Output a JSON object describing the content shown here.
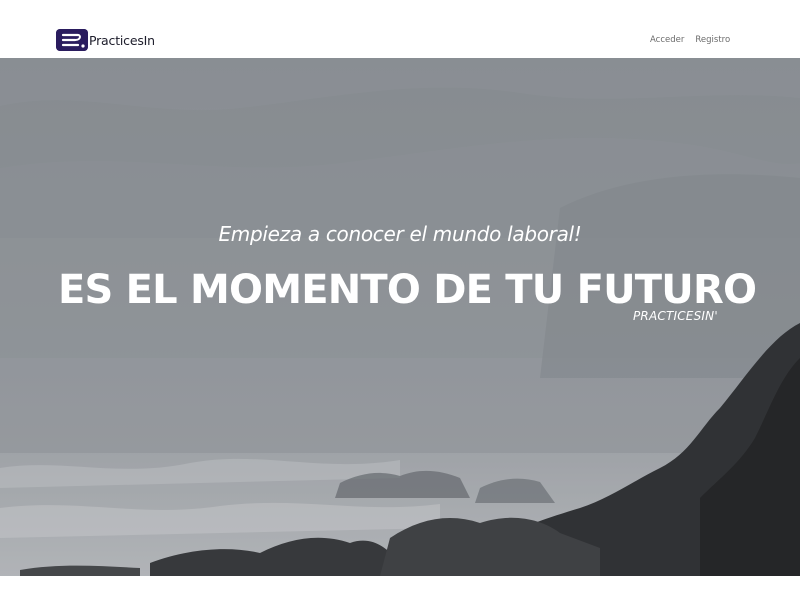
{
  "navbar": {
    "brand_name": "PracticesIn",
    "brand_logo_icon": "practicesin-logo-icon",
    "brand_color": "#2a1c5e",
    "links": [
      {
        "label": "Acceder"
      },
      {
        "label": "Registro"
      }
    ]
  },
  "hero": {
    "tagline": "Empieza a conocer el mundo laboral!",
    "headline": "ES EL MOMENTO DE TU FUTURO",
    "signature": "PRACTICESIN'",
    "background": "misty-coastline-grayscale-photo"
  }
}
